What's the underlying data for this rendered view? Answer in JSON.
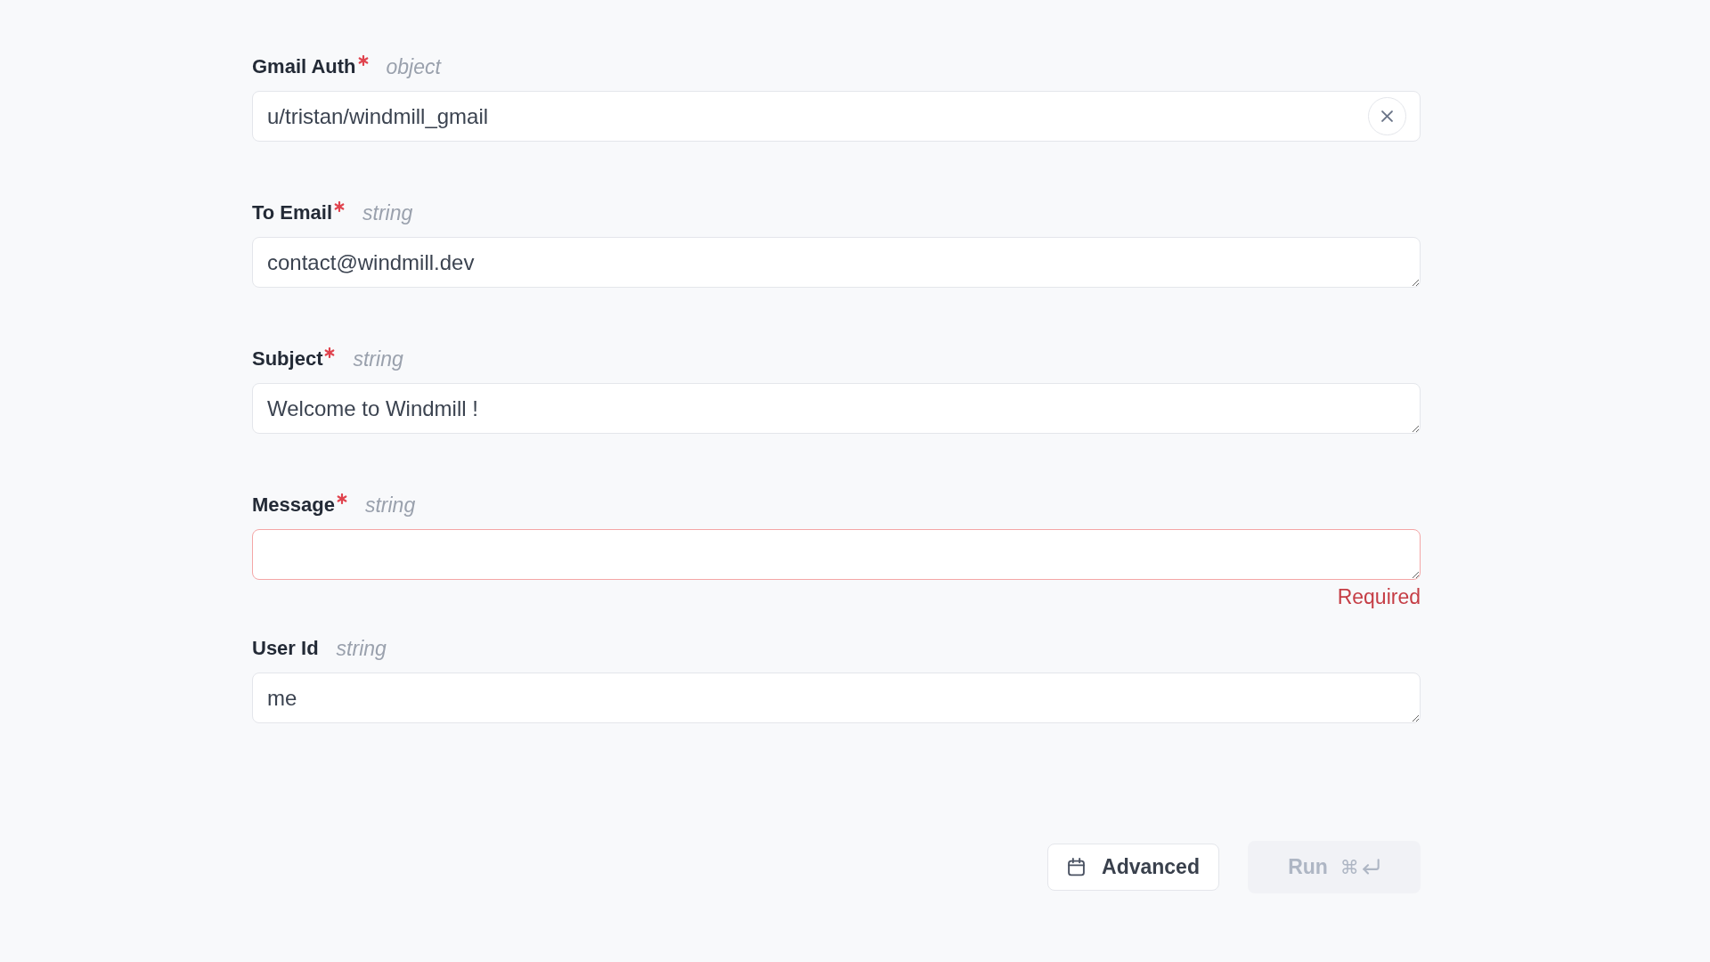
{
  "fields": [
    {
      "label": "Gmail Auth",
      "required": true,
      "type": "object",
      "kind": "picker",
      "value": "u/tristan/windmill_gmail"
    },
    {
      "label": "To Email",
      "required": true,
      "type": "string",
      "kind": "text",
      "value": "contact@windmill.dev"
    },
    {
      "label": "Subject",
      "required": true,
      "type": "string",
      "kind": "text",
      "value": "Welcome to Windmill !"
    },
    {
      "label": "Message",
      "required": true,
      "type": "string",
      "kind": "text",
      "error": "Required"
    },
    {
      "label": "User Id",
      "required": false,
      "type": "string",
      "kind": "text",
      "value": "me"
    }
  ],
  "actions": {
    "advanced": {
      "label": "Advanced"
    },
    "run": {
      "label": "Run",
      "shortcut": "⌘",
      "disabled": true
    }
  }
}
